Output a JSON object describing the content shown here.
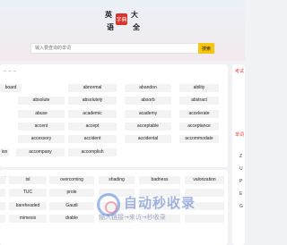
{
  "logo": {
    "chars": [
      "英",
      "语",
      "大",
      "全"
    ],
    "seal": "字典"
  },
  "search": {
    "placeholder": "输入要查询的单词",
    "button_label": "搜索"
  },
  "words": {
    "row1": [
      "board",
      "abnormal",
      "abandon",
      "ability"
    ],
    "row2": [
      "absolute",
      "absolutely",
      "absorb",
      "abstract"
    ],
    "row3": [
      "abuse",
      "academic",
      "academy",
      "accelerate"
    ],
    "row4": [
      "accent",
      "accept",
      "acceptable",
      "acceptance"
    ],
    "row5": [
      "accessory",
      "accident",
      "accidental",
      "accommodate"
    ],
    "row6": [
      "ion",
      "accompany",
      "accomplish"
    ],
    "row7": [
      "",
      "tsl",
      "overcoming",
      "shading",
      "badness",
      "valorization"
    ],
    "row8": [
      "",
      "TUC",
      "prole",
      "",
      "",
      ""
    ],
    "row9": [
      "",
      "bareheaded",
      "Gaudi",
      "",
      "",
      ""
    ],
    "row10": [
      "",
      "mimesis",
      "drable",
      "",
      "",
      ""
    ]
  },
  "sidebar": {
    "title1": "考试",
    "title2": "单词",
    "letters": [
      "Z",
      "U",
      "P",
      "E",
      "G"
    ]
  },
  "watermark": {
    "title": "自动秒收录",
    "subtitle": "输入链接→来访→秒收录"
  }
}
